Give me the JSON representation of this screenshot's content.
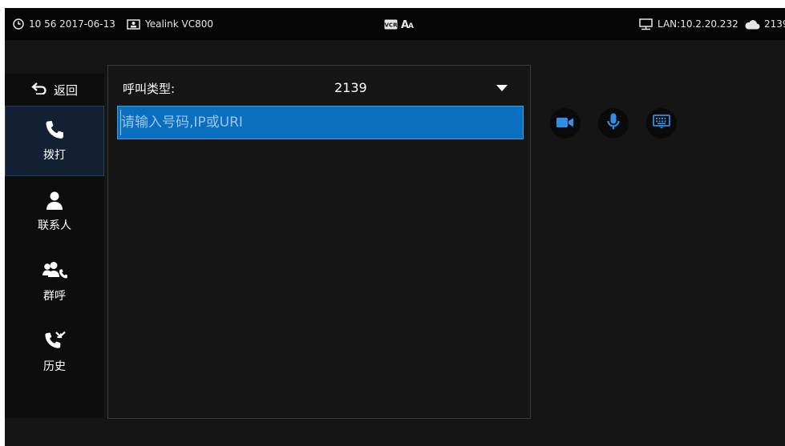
{
  "status_bar": {
    "time": "10 56 2017-06-13",
    "device": "Yealink VC800",
    "lan": "LAN:10.2.20.232",
    "account": "2139",
    "icons": [
      "clock-icon",
      "display-icon",
      "vcr-icon",
      "font-size-icon",
      "network-icon",
      "cloud-icon"
    ]
  },
  "sidebar": {
    "back_label": "返回",
    "items": [
      {
        "label": "拨打",
        "icon": "phone-icon",
        "active": true
      },
      {
        "label": "联系人",
        "icon": "contact-icon",
        "active": false
      },
      {
        "label": "群呼",
        "icon": "group-icon",
        "active": false
      },
      {
        "label": "历史",
        "icon": "history-icon",
        "active": false
      }
    ]
  },
  "dial_panel": {
    "call_type_label": "呼叫类型:",
    "call_type_value": "2139",
    "input_value": "",
    "input_placeholder": "请输入号码,IP或URI"
  },
  "actions": [
    {
      "icon": "video-call-icon"
    },
    {
      "icon": "microphone-icon"
    },
    {
      "icon": "keyboard-icon"
    }
  ],
  "colors": {
    "accent": "#0b6fc0",
    "background": "#151515",
    "active_nav": "#142033"
  }
}
